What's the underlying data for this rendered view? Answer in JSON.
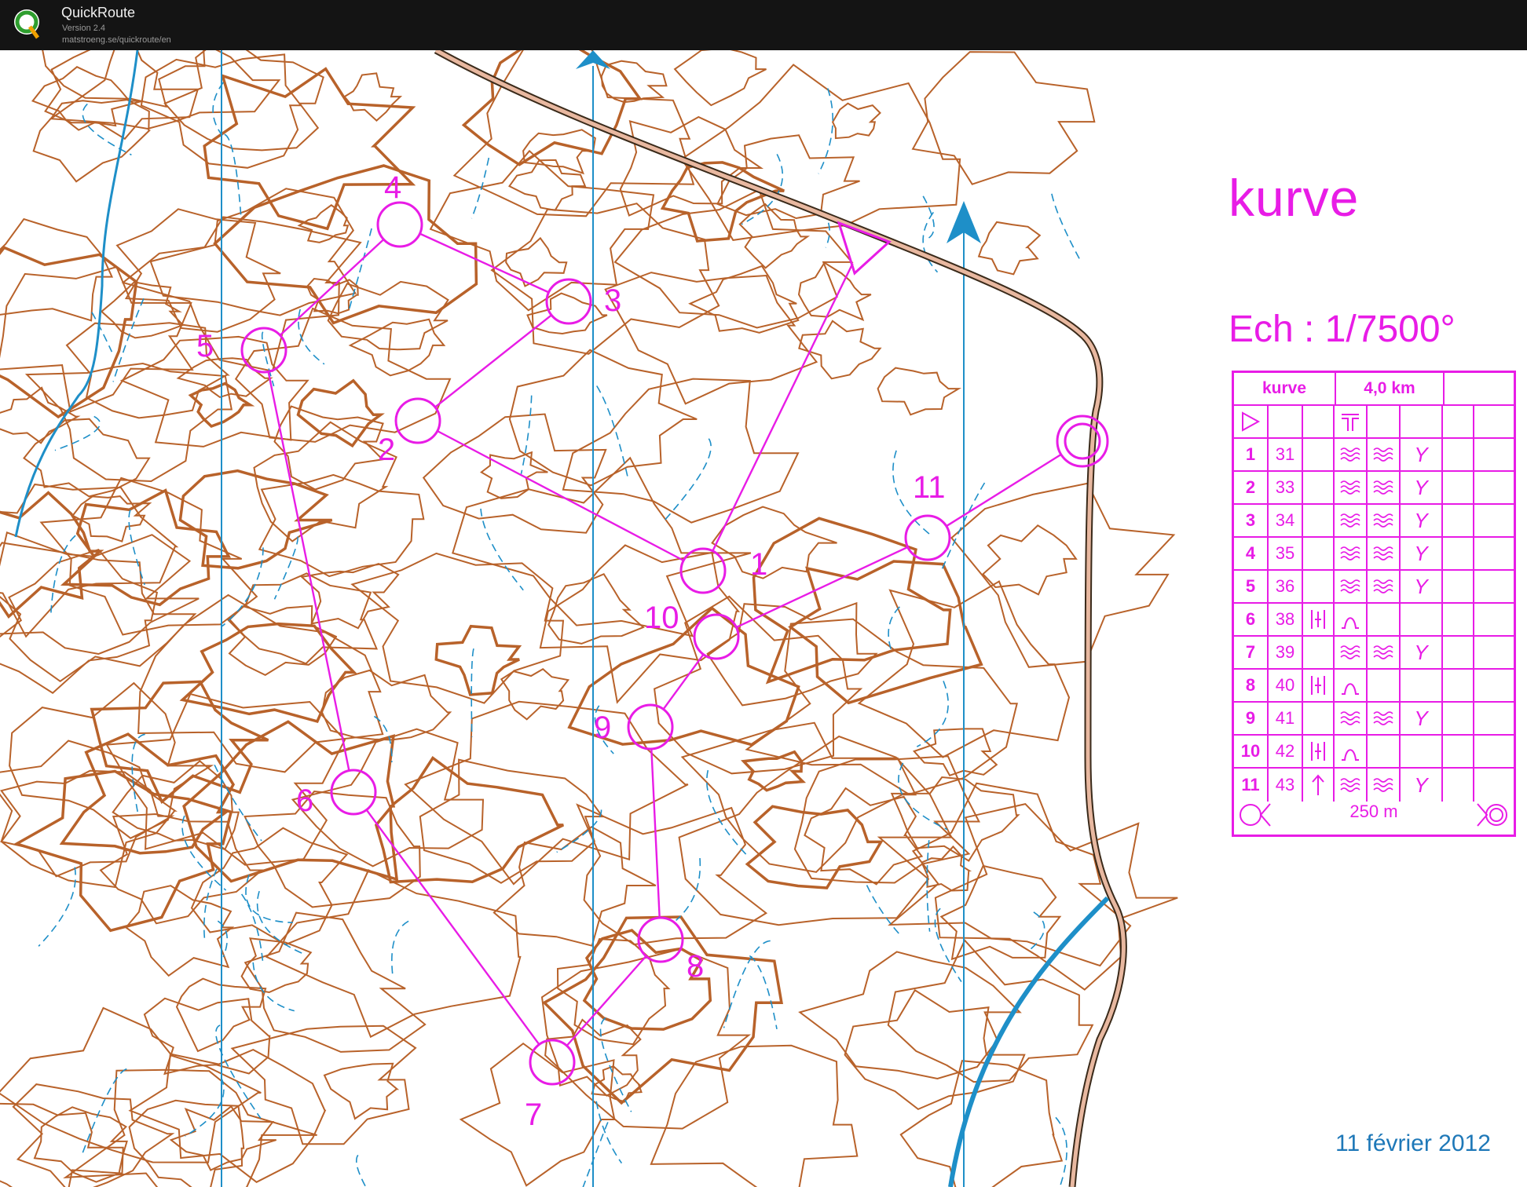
{
  "app": {
    "title": "QuickRoute",
    "version": "Version 2.4",
    "url": "matstroeng.se/quickroute/en",
    "logo_letter": "Q"
  },
  "map": {
    "course_name": "kurve",
    "scale": "Ech : 1/7500°",
    "date": "11 février 2012",
    "control_labels": [
      "1",
      "2",
      "3",
      "4",
      "5",
      "6",
      "7",
      "8",
      "9",
      "10",
      "11"
    ],
    "colors": {
      "course": "#e81ce6",
      "contour": "#b8622a",
      "water": "#1e8fc8",
      "north_lines": "#1e8fc8",
      "road": "#b8622a"
    }
  },
  "description": {
    "header": {
      "course": "kurve",
      "length": "4,0 km"
    },
    "start_symbols": [
      "triangle-icon",
      "road-junction-icon"
    ],
    "rows": [
      {
        "num": "1",
        "code": "31",
        "c": "",
        "d": "reentrant-icon",
        "e": "reentrant-icon",
        "f": "Y"
      },
      {
        "num": "2",
        "code": "33",
        "c": "",
        "d": "reentrant-icon",
        "e": "reentrant-icon",
        "f": "Y"
      },
      {
        "num": "3",
        "code": "34",
        "c": "",
        "d": "reentrant-icon",
        "e": "reentrant-icon",
        "f": "Y"
      },
      {
        "num": "4",
        "code": "35",
        "c": "",
        "d": "reentrant-icon",
        "e": "reentrant-icon",
        "f": "Y"
      },
      {
        "num": "5",
        "code": "36",
        "c": "",
        "d": "reentrant-icon",
        "e": "reentrant-icon",
        "f": "Y"
      },
      {
        "num": "6",
        "code": "38",
        "c": "between-icon",
        "d": "knoll-icon",
        "e": "",
        "f": ""
      },
      {
        "num": "7",
        "code": "39",
        "c": "",
        "d": "reentrant-icon",
        "e": "reentrant-icon",
        "f": "Y"
      },
      {
        "num": "8",
        "code": "40",
        "c": "between-icon",
        "d": "knoll-icon",
        "e": "",
        "f": ""
      },
      {
        "num": "9",
        "code": "41",
        "c": "",
        "d": "reentrant-icon",
        "e": "reentrant-icon",
        "f": "Y"
      },
      {
        "num": "10",
        "code": "42",
        "c": "between-icon",
        "d": "knoll-icon",
        "e": "",
        "f": ""
      },
      {
        "num": "11",
        "code": "43",
        "c": "up-arrow-icon",
        "d": "reentrant-icon",
        "e": "reentrant-icon",
        "f": "Y"
      }
    ],
    "footer": "250 m"
  }
}
